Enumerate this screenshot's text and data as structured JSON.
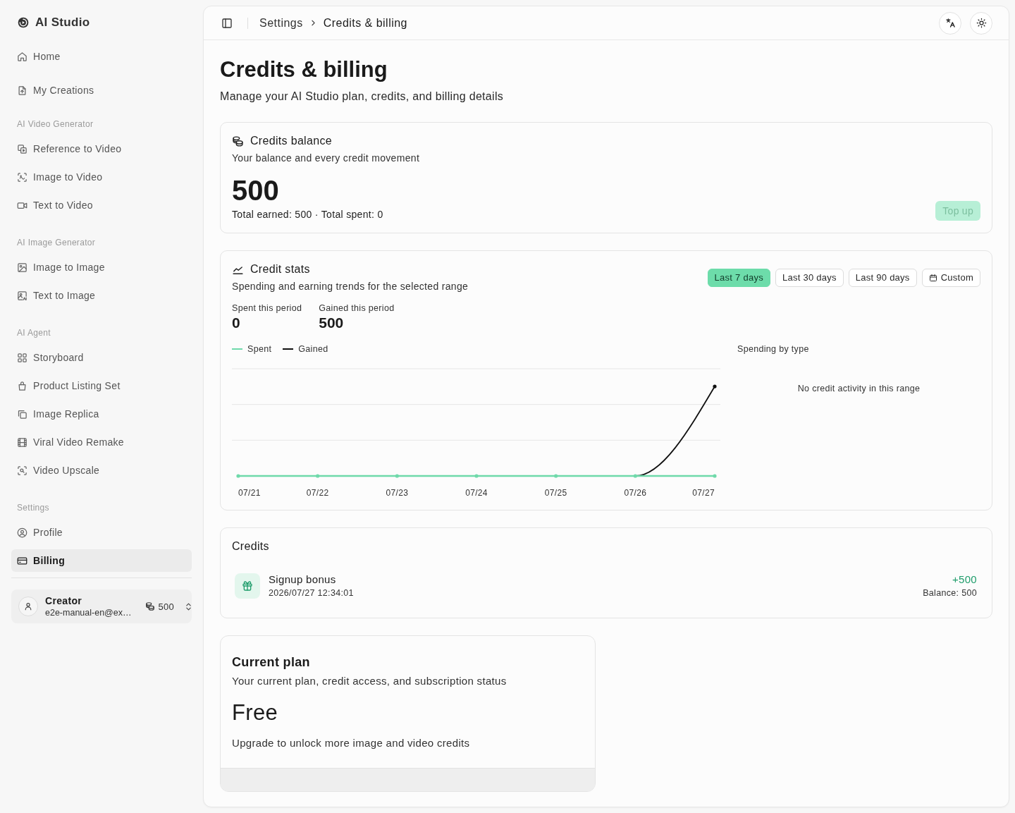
{
  "sidebar": {
    "brand": "AI Studio",
    "sections": [
      {
        "items": [
          {
            "label": "Home",
            "selected": false
          },
          {
            "label": "My Creations",
            "selected": false
          }
        ]
      },
      {
        "title": "AI Video Generator",
        "items": [
          {
            "label": "Reference to Video",
            "selected": false
          },
          {
            "label": "Image to Video",
            "selected": false
          },
          {
            "label": "Text to Video",
            "selected": false
          }
        ]
      },
      {
        "title": "AI Image Generator",
        "items": [
          {
            "label": "Image to Image",
            "selected": false
          },
          {
            "label": "Text to Image",
            "selected": false
          }
        ]
      },
      {
        "title": "AI Agent",
        "items": [
          {
            "label": "Storyboard",
            "selected": false
          },
          {
            "label": "Product Listing Set",
            "selected": false
          },
          {
            "label": "Image Replica",
            "selected": false
          },
          {
            "label": "Viral Video Remake",
            "selected": false
          },
          {
            "label": "Video Upscale",
            "selected": false
          }
        ]
      },
      {
        "title": "Settings",
        "items": [
          {
            "label": "Profile",
            "selected": false
          },
          {
            "label": "Billing",
            "selected": true
          }
        ]
      }
    ],
    "user": {
      "name": "Creator",
      "email": "e2e-manual-en@ex…",
      "credits": "500"
    }
  },
  "header": {
    "breadcrumb": [
      "Settings",
      "Credits & billing"
    ]
  },
  "page": {
    "title": "Credits & billing",
    "subtitle": "Manage your AI Studio plan, credits, and billing details"
  },
  "balance_card": {
    "title": "Credits balance",
    "subtitle": "Your balance and every credit movement",
    "balance": "500",
    "totals": "Total earned: 500 · Total spent: 0",
    "top_up": {
      "label": "Top up",
      "disabled": true
    }
  },
  "stats_card": {
    "title": "Credit stats",
    "subtitle": "Spending and earning trends for the selected range",
    "ranges": [
      {
        "label": "Last 7 days",
        "kind": "preset",
        "selected": true
      },
      {
        "label": "Last 30 days",
        "kind": "preset",
        "selected": false
      },
      {
        "label": "Last 90 days",
        "kind": "preset",
        "selected": false
      },
      {
        "label": "Custom",
        "kind": "custom",
        "selected": false
      }
    ],
    "stats": [
      {
        "label": "Spent this period",
        "value": "0"
      },
      {
        "label": "Gained this period",
        "value": "500"
      }
    ],
    "trend_chart": {
      "legend": [
        {
          "name": "Spent",
          "color": "#6fd9aa"
        },
        {
          "name": "Gained",
          "color": "#111111"
        }
      ],
      "x_labels": [
        "07/21",
        "07/22",
        "07/23",
        "07/24",
        "07/25",
        "07/26",
        "07/27"
      ]
    },
    "breakdown": {
      "title": "Spending by type",
      "empty_text": "No credit activity in this range"
    }
  },
  "credits_card": {
    "title": "Credits",
    "entries": [
      {
        "kind": "credit",
        "title": "Signup bonus",
        "time": "2026/07/27 12:34:01",
        "amount": "+500",
        "balance": "Balance: 500"
      }
    ]
  },
  "plan_card": {
    "title": "Current plan",
    "subtitle": "Your current plan, credit access, and subscription status",
    "plan": "Free",
    "note": "Upgrade to unlock more image and video credits"
  }
}
